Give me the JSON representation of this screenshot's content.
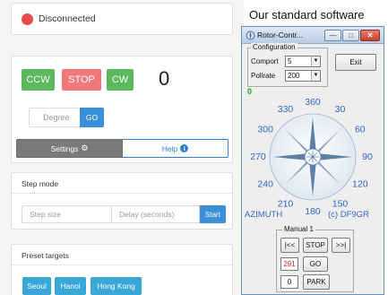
{
  "web_ui": {
    "status": {
      "text": "Disconnected",
      "color": "#e84b4b"
    },
    "controls": {
      "ccw_label": "CCW",
      "stop_label": "STOP",
      "cw_label": "CW",
      "current_azimuth": "0"
    },
    "degree": {
      "placeholder": "Degree",
      "go_label": "GO"
    },
    "tabs": [
      {
        "label": "Settings",
        "icon": "gear-icon"
      },
      {
        "label": "Help",
        "icon": "info-icon"
      }
    ],
    "step_mode": {
      "title": "Step mode",
      "step_size_placeholder": "Step size",
      "delay_placeholder": "Delay (seconds)",
      "start_label": "Start"
    },
    "presets": {
      "title": "Preset targets",
      "buttons": [
        "Seoul",
        "Hanoi",
        "Hong Kong"
      ]
    }
  },
  "caption": "Our standard software",
  "desktop_app": {
    "title": "Rotor-Contr...",
    "window_buttons": {
      "minimize": "—",
      "maximize": "□",
      "close": "✕"
    },
    "configuration": {
      "legend": "Configuration",
      "comport_label": "Comport",
      "comport_value": "5",
      "pollrate_label": "Pollrate",
      "pollrate_value": "200"
    },
    "exit_label": "Exit",
    "indicator": "0",
    "compass_labels": [
      "360",
      "30",
      "60",
      "90",
      "120",
      "150",
      "180",
      "210",
      "240",
      "270",
      "300",
      "330"
    ],
    "azimuth_label": "AZIMUTH",
    "copyright": "(c) DF9GR",
    "manual": {
      "legend": "Manual 1",
      "ccw": "|<<",
      "stop": "STOP",
      "cw": ">>|",
      "az_value": "291",
      "go": "GO",
      "park_value": "0",
      "park": "PARK"
    }
  }
}
